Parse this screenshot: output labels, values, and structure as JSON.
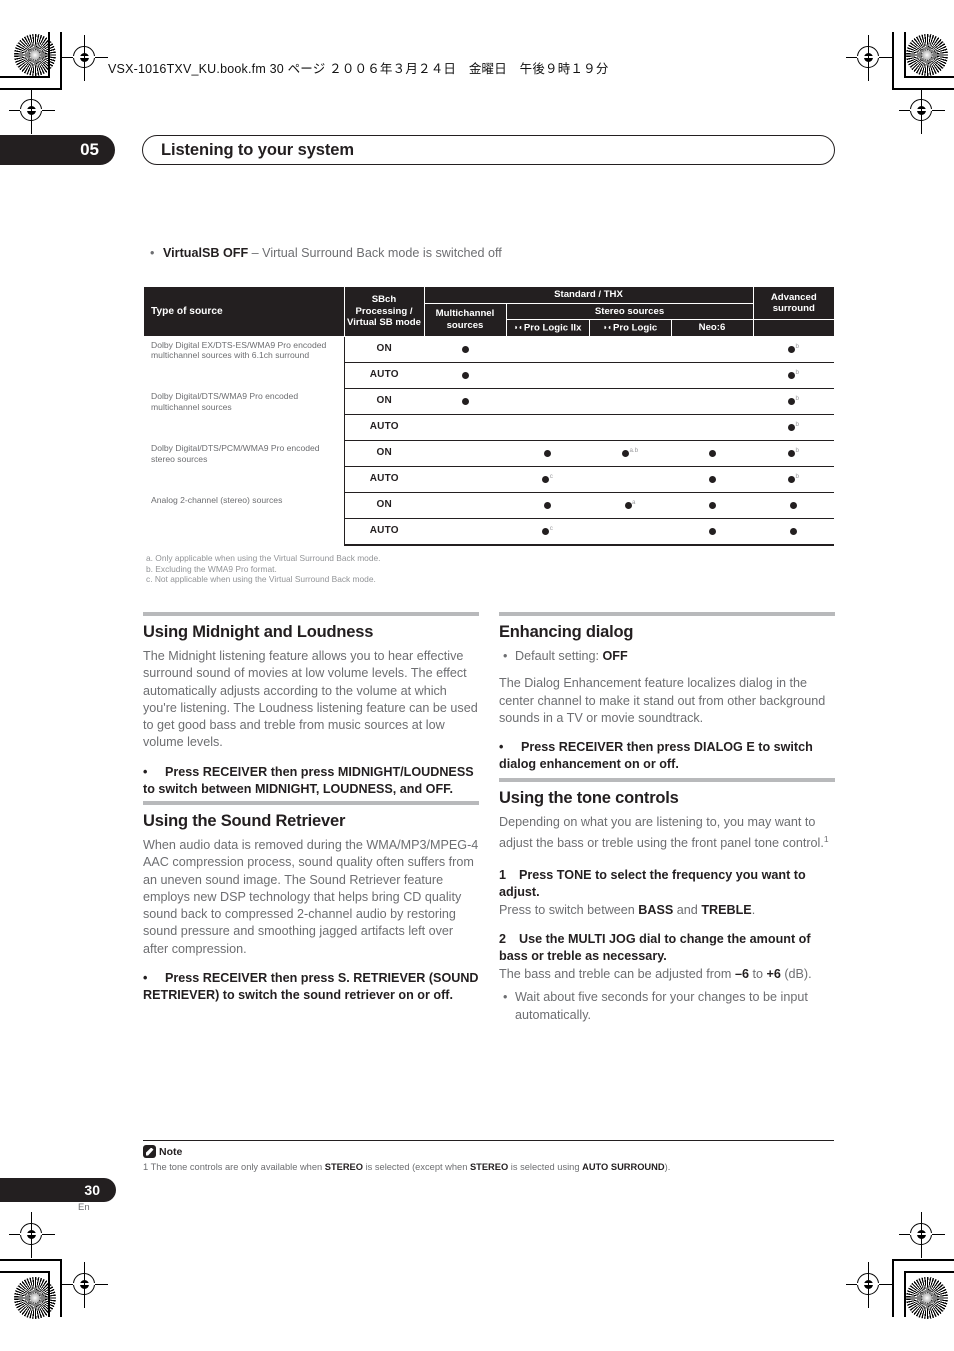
{
  "page": {
    "file_header": "VSX-1016TXV_KU.book.fm 30 ページ ２００６年３月２４日　金曜日　午後９時１９分",
    "chapter_number": "05",
    "chapter_title": "Listening to your system",
    "page_number": "30",
    "page_language": "En"
  },
  "lead_bullet": {
    "bold": "VirtualSB OFF",
    "rest": " – Virtual Surround Back mode is switched off"
  },
  "table": {
    "headers": {
      "type_of_source": "Type of source",
      "sbch": "SBch Processing / Virtual SB mode",
      "standard_thx": "Standard / THX",
      "multichannel": "Multichannel sources",
      "stereo_sources": "Stereo sources",
      "pro_logic_iix": "Pro Logic IIx",
      "pro_logic": "Pro Logic",
      "neo6": "Neo:6",
      "advanced_surround": "Advanced surround"
    },
    "groups": [
      {
        "source": "Dolby Digital EX/DTS-ES/WMA9 Pro encoded multichannel sources with 6.1ch surround",
        "rows": [
          {
            "mode": "ON",
            "multichannel": "dot",
            "plii x": "",
            "pro_logic_iix": "",
            "pro_logic": "",
            "neo6": "",
            "advanced": "dot",
            "advanced_sup": "b"
          },
          {
            "mode": "AUTO",
            "multichannel": "dot",
            "pro_logic_iix": "",
            "pro_logic": "",
            "neo6": "",
            "advanced": "dot",
            "advanced_sup": "b"
          }
        ]
      },
      {
        "source": "Dolby Digital/DTS/WMA9 Pro encoded multichannel sources",
        "rows": [
          {
            "mode": "ON",
            "multichannel": "dot",
            "pro_logic_iix": "",
            "pro_logic": "",
            "neo6": "",
            "advanced": "dot",
            "advanced_sup": "b"
          },
          {
            "mode": "AUTO",
            "multichannel": "",
            "pro_logic_iix": "",
            "pro_logic": "",
            "neo6": "",
            "advanced": "dot",
            "advanced_sup": "b"
          }
        ]
      },
      {
        "source": "Dolby Digital/DTS/PCM/WMA9 Pro encoded stereo sources",
        "rows": [
          {
            "mode": "ON",
            "multichannel": "",
            "pro_logic_iix": "dot",
            "pro_logic_iix_sup": "",
            "pro_logic": "dot",
            "pro_logic_sup": "a.b",
            "neo6": "dot",
            "advanced": "dot",
            "advanced_sup": "b"
          },
          {
            "mode": "AUTO",
            "multichannel": "",
            "pro_logic_iix": "dot",
            "pro_logic_iix_sup": "c",
            "pro_logic": "",
            "neo6": "dot",
            "advanced": "dot",
            "advanced_sup": "b"
          }
        ]
      },
      {
        "source": "Analog 2-channel (stereo) sources",
        "rows": [
          {
            "mode": "ON",
            "multichannel": "",
            "pro_logic_iix": "dot",
            "pro_logic_iix_sup": "",
            "pro_logic": "dot",
            "pro_logic_sup": "a",
            "neo6": "dot",
            "advanced": "dot",
            "advanced_sup": ""
          },
          {
            "mode": "AUTO",
            "multichannel": "",
            "pro_logic_iix": "dot",
            "pro_logic_iix_sup": "c",
            "pro_logic": "",
            "neo6": "dot",
            "advanced": "dot",
            "advanced_sup": ""
          }
        ]
      }
    ],
    "footnotes": [
      "a. Only applicable when using the Virtual Surround Back mode.",
      "b. Excluding the WMA9 Pro format.",
      "c. Not applicable when using the Virtual Surround Back mode."
    ]
  },
  "sections": {
    "midnight": {
      "title": "Using Midnight and Loudness",
      "body": "The Midnight listening feature allows you to hear effective surround sound of movies at low volume levels. The effect automatically adjusts according to the volume at which you're listening. The Loudness listening feature can be used to get good bass and treble from music sources at low volume levels.",
      "instruction": "Press RECEIVER then press MIDNIGHT/LOUDNESS to switch between MIDNIGHT, LOUDNESS, and OFF."
    },
    "retriever": {
      "title": "Using the Sound Retriever",
      "body": "When audio data is removed during the WMA/MP3/MPEG-4 AAC compression process, sound quality often suffers from an uneven sound image. The Sound Retriever feature employs new DSP technology that helps bring CD quality sound back to compressed 2-channel audio by restoring sound pressure and smoothing jagged artifacts left over after compression.",
      "instruction": "Press RECEIVER then press S. RETRIEVER (SOUND RETRIEVER) to switch the sound retriever on or off."
    },
    "dialog": {
      "title": "Enhancing dialog",
      "default_label": "Default setting: ",
      "default_value": "OFF",
      "body": "The Dialog Enhancement feature localizes dialog in the center channel to make it stand out from other background sounds in a TV or movie soundtrack.",
      "instruction": "Press RECEIVER then press DIALOG E to switch dialog enhancement on or off."
    },
    "tone": {
      "title": "Using the tone controls",
      "body_a": "Depending on what you are listening to, you may want to adjust the bass or treble using the front panel tone control.",
      "body_a_sup": "1",
      "step1_num": "1",
      "step1": "Press TONE to select the frequency you want to adjust.",
      "step1_sub_a": "Press to switch between ",
      "step1_sub_b": "BASS",
      "step1_sub_c": " and ",
      "step1_sub_d": "TREBLE",
      "step1_sub_e": ".",
      "step2_num": "2",
      "step2": "Use the MULTI JOG dial to change the amount of bass or treble as necessary.",
      "step2_sub_a": "The bass and treble can be adjusted from ",
      "step2_sub_min": "–6",
      "step2_sub_b": " to ",
      "step2_sub_max": "+6",
      "step2_sub_c": " (dB).",
      "bullet": "Wait about five seconds for your changes to be input automatically."
    }
  },
  "footer_note": {
    "label": "Note",
    "number": "1 ",
    "text_a": "The tone controls are only available when ",
    "stereo_1": "STEREO",
    "text_b": " is selected (except when ",
    "stereo_2": "STEREO",
    "text_c": " is selected using ",
    "auto_surround": "AUTO SURROUND",
    "text_d": ")."
  }
}
